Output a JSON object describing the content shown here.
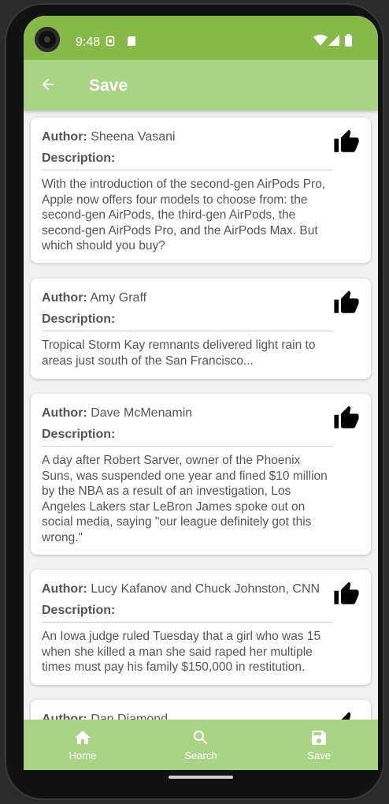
{
  "status_bar": {
    "time": "9:48"
  },
  "app_bar": {
    "title": "Save"
  },
  "labels": {
    "author": "Author:",
    "description": "Description:"
  },
  "articles": [
    {
      "author": "Sheena Vasani",
      "description": "With the introduction of the second-gen AirPods Pro, Apple now offers four models to choose from: the second-gen AirPods, the third-gen AirPods, the second-gen AirPods Pro, and the AirPods Max. But which should you buy?"
    },
    {
      "author": "Amy Graff",
      "description": "Tropical Storm Kay remnants delivered light rain to areas just south of the San Francisco..."
    },
    {
      "author": "Dave McMenamin",
      "description": "A day after Robert Sarver, owner of the Phoenix Suns, was suspended one year and fined $10 million by the NBA as a result of an investigation, Los Angeles Lakers star LeBron James spoke out on social media, saying \"our league definitely got this wrong.\""
    },
    {
      "author": "Lucy Kafanov and Chuck Johnston, CNN",
      "description": "An Iowa judge ruled Tuesday that a girl who was 15 when she killed a man she said raped her multiple times must pay his family $150,000 in restitution."
    },
    {
      "author": "Dan Diamond",
      "description": ""
    }
  ],
  "bottom_nav": [
    {
      "label": "Home",
      "icon": "home-icon"
    },
    {
      "label": "Search",
      "icon": "search-icon"
    },
    {
      "label": "Save",
      "icon": "save-icon"
    }
  ],
  "colors": {
    "status_bar": "#86b94a",
    "app_bar": "#aad385",
    "bottom_nav": "#aad385",
    "text": "#555555"
  }
}
